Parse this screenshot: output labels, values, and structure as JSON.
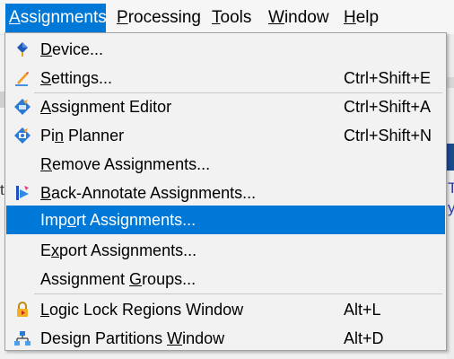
{
  "menubar": {
    "items": [
      {
        "pre": "",
        "key": "A",
        "post": "ssignments",
        "active": true
      },
      {
        "pre": "",
        "key": "P",
        "post": "rocessing"
      },
      {
        "pre": "",
        "key": "T",
        "post": "ools"
      },
      {
        "pre": "",
        "key": "W",
        "post": "indow"
      },
      {
        "pre": "",
        "key": "H",
        "post": "elp"
      }
    ]
  },
  "background": {
    "side_glyph": "t",
    "right_glyph_top": "T",
    "right_glyph_bottom": "y"
  },
  "menu": {
    "items": [
      {
        "pre": "",
        "key": "D",
        "post": "evice...",
        "shortcut": "",
        "icon": "device-icon"
      },
      {
        "pre": "",
        "key": "S",
        "post": "ettings...",
        "shortcut": "Ctrl+Shift+E",
        "icon": "settings-pencil-icon"
      },
      {
        "pre": "",
        "key": "A",
        "post": "ssignment Editor",
        "shortcut": "Ctrl+Shift+A",
        "icon": "assignment-editor-icon"
      },
      {
        "pre": "Pi",
        "key": "n",
        "post": " Planner",
        "shortcut": "Ctrl+Shift+N",
        "icon": "pin-planner-icon"
      },
      {
        "pre": "",
        "key": "R",
        "post": "emove Assignments...",
        "shortcut": "",
        "icon": ""
      },
      {
        "pre": "",
        "key": "B",
        "post": "ack-Annotate Assignments...",
        "shortcut": "",
        "icon": "back-annotate-icon"
      },
      {
        "pre": "Imp",
        "key": "o",
        "post": "rt Assignments...",
        "shortcut": "",
        "icon": "",
        "highlight": true
      },
      {
        "pre": "E",
        "key": "x",
        "post": "port Assignments...",
        "shortcut": "",
        "icon": ""
      },
      {
        "pre": "Assignment ",
        "key": "G",
        "post": "roups...",
        "shortcut": "",
        "icon": ""
      },
      {
        "pre": "",
        "key": "L",
        "post": "ogic Lock Regions Window",
        "shortcut": "Alt+L",
        "icon": "logic-lock-icon"
      },
      {
        "pre": "Design Partitions ",
        "key": "W",
        "post": "indow",
        "shortcut": "Alt+D",
        "icon": "design-partitions-icon"
      }
    ]
  },
  "colors": {
    "accent": "#0078d7",
    "menu_bg": "#f2f2f2"
  }
}
